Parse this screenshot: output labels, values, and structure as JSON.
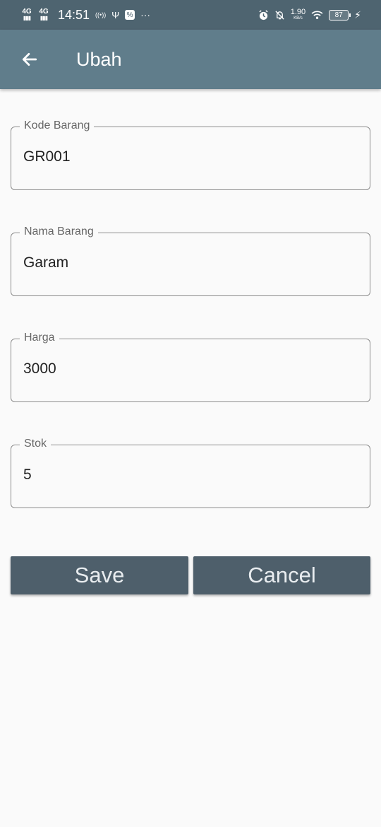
{
  "status_bar": {
    "network_1": "4G",
    "network_2": "4G",
    "time": "14:51",
    "hotspot_icon": "((•))",
    "usb_icon": "Ψ",
    "app_icon": "%",
    "more": "···",
    "alarm_icon": "alarm-icon",
    "mute_icon": "bell-off-icon",
    "speed_value": "1.90",
    "speed_unit": "KB/s",
    "battery_level": "87"
  },
  "app_bar": {
    "title": "Ubah",
    "back_icon": "arrow-left-icon"
  },
  "form": {
    "kode_label": "Kode Barang",
    "kode_value": "GR001",
    "nama_label": "Nama Barang",
    "nama_value": "Garam",
    "harga_label": "Harga",
    "harga_value": "3000",
    "stok_label": "Stok",
    "stok_value": "5"
  },
  "buttons": {
    "save_label": "Save",
    "cancel_label": "Cancel"
  },
  "colors": {
    "status_bar": "#4e6470",
    "app_bar": "#607d8b",
    "button": "#4e5f6b",
    "background": "#fafafa"
  }
}
